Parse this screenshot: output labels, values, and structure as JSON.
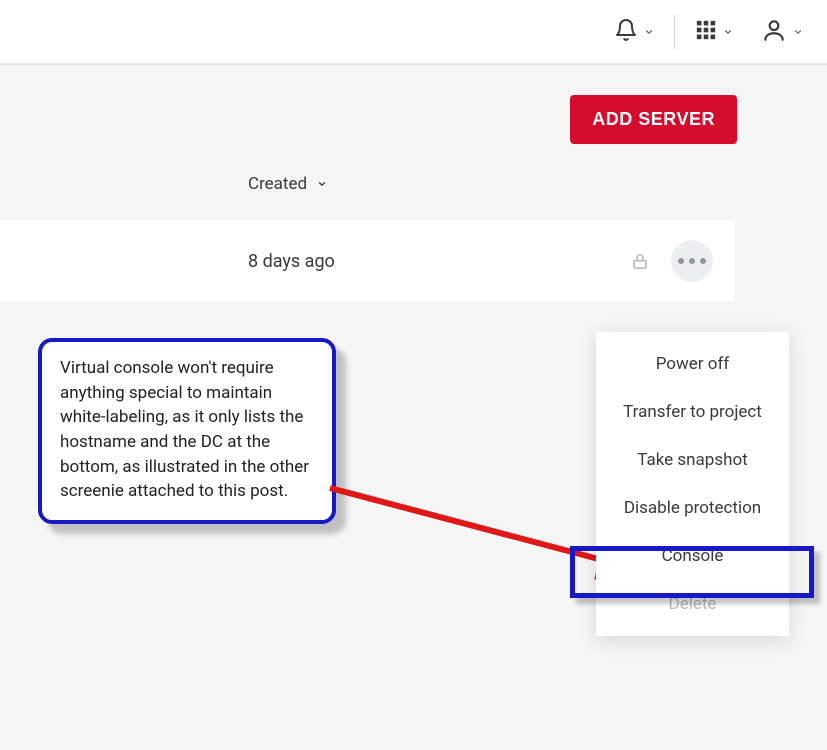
{
  "topbar": {
    "bell_name": "bell-icon",
    "apps_name": "apps-icon",
    "profile_name": "profile-icon"
  },
  "actions": {
    "add_server_label": "ADD SERVER"
  },
  "columns": {
    "created_label": "Created"
  },
  "row": {
    "time_text": "8 days ago"
  },
  "callout": {
    "text": "Virtual console won't require anything special to maintain white-labeling, as it only lists the hostname and the DC at the bottom, as illustrated in the other screenie attached to this post."
  },
  "menu": {
    "items": [
      {
        "label": "Power off",
        "disabled": false
      },
      {
        "label": "Transfer to project",
        "disabled": false
      },
      {
        "label": "Take snapshot",
        "disabled": false
      },
      {
        "label": "Disable protection",
        "disabled": false
      },
      {
        "label": "Console",
        "disabled": false
      },
      {
        "label": "Delete",
        "disabled": true
      }
    ]
  }
}
